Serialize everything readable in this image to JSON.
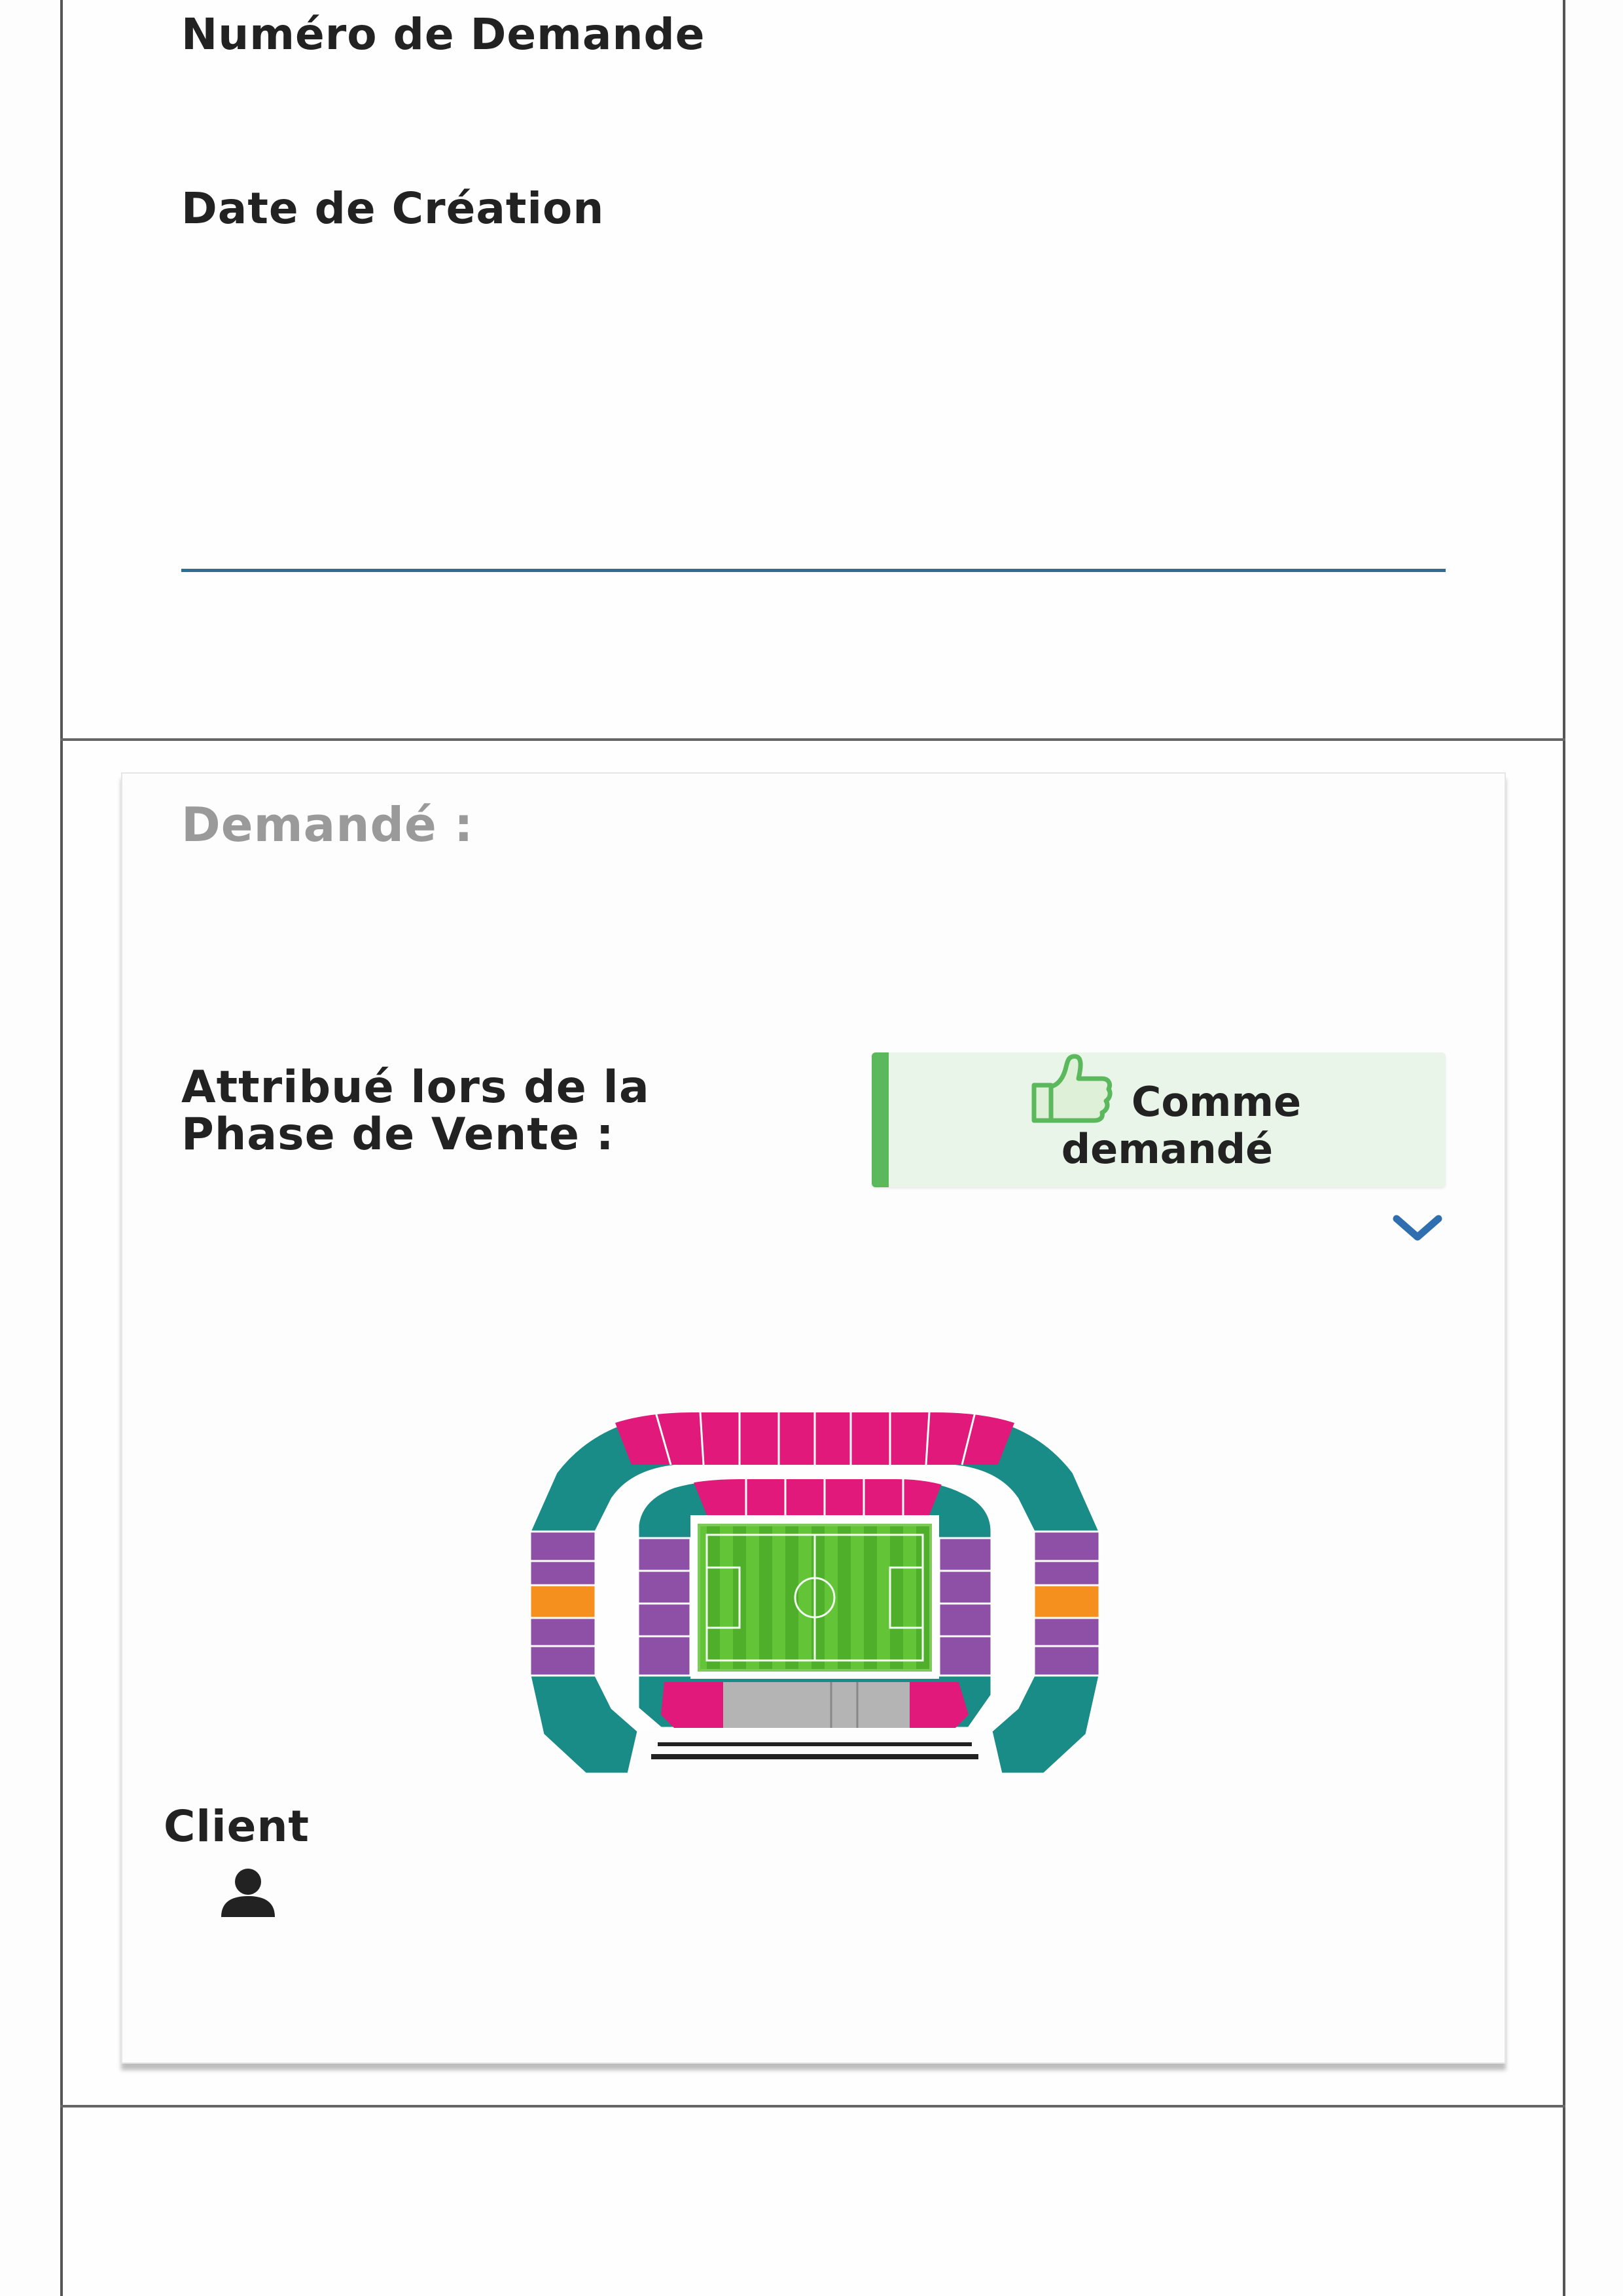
{
  "request": {
    "number_label": "Numéro de Demande",
    "created_label": "Date de Création"
  },
  "card": {
    "requested_label": "Demandé :",
    "assigned_label_line1": "Attribué lors de la",
    "assigned_label_line2": "Phase de Vente :",
    "status_badge": {
      "line1": "Comme",
      "line2": "demandé",
      "icon": "thumbs-up-icon",
      "accent_color": "#5cb85c"
    },
    "expand_icon": "chevron-down-icon",
    "client_label": "Client",
    "client_icon": "user-icon"
  },
  "colors": {
    "pink": "#e0197a",
    "teal": "#1a8c87",
    "purple": "#8e4fa6",
    "orange": "#f5901e",
    "pitch": "#5ab82f",
    "accent_line": "#2c6f93"
  }
}
